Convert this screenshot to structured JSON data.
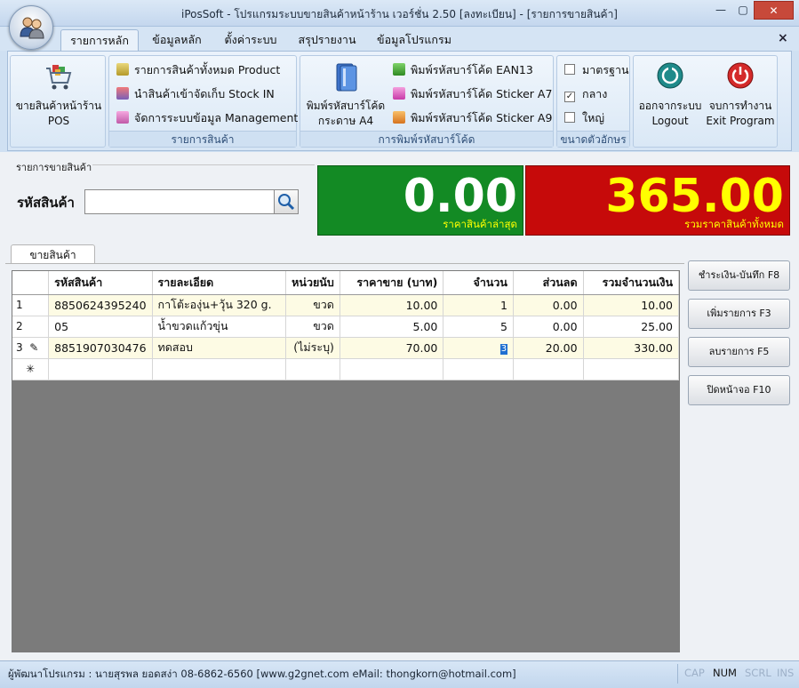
{
  "window": {
    "title": "iPosSoft - โปรแกรมระบบขายสินค้าหน้าร้าน เวอร์ชั่น 2.50 [ลงทะเบียน] - [รายการขายสินค้า]",
    "min_glyph": "—",
    "max_glyph": "▢",
    "close_glyph": "✕"
  },
  "tabs": [
    {
      "label": "รายการหลัก",
      "active": true
    },
    {
      "label": "ข้อมูลหลัก"
    },
    {
      "label": "ตั้งค่าระบบ"
    },
    {
      "label": "สรุปรายงาน"
    },
    {
      "label": "ข้อมูลโปรแกรม"
    }
  ],
  "ribbon": {
    "close_glyph": "×",
    "pos": {
      "line1": "ขายสินค้าหน้าร้าน",
      "line2": "POS"
    },
    "products_group": {
      "label": "รายการสินค้า",
      "items": [
        {
          "label": "รายการสินค้าทั้งหมด Product"
        },
        {
          "label": "นำสินค้าเข้าจัดเก็บ Stock IN"
        },
        {
          "label": "จัดการระบบข้อมูล Management"
        }
      ]
    },
    "barcode_group": {
      "label": "การพิมพ์รหัสบาร์โค้ด",
      "a4": {
        "line1": "พิมพ์รหัสบาร์โค้ด",
        "line2": "กระดาษ A4"
      },
      "items": [
        {
          "label": "พิมพ์รหัสบาร์โค้ด EAN13"
        },
        {
          "label": "พิมพ์รหัสบาร์โค้ด Sticker A7"
        },
        {
          "label": "พิมพ์รหัสบาร์โค้ด Sticker A9"
        }
      ]
    },
    "font_group": {
      "label": "ขนาดตัวอักษร",
      "options": [
        {
          "label": "มาตรฐาน",
          "checked": false
        },
        {
          "label": "กลาง",
          "checked": true
        },
        {
          "label": "ใหญ่",
          "checked": false
        }
      ]
    },
    "logout": {
      "line1": "ออกจากระบบ",
      "line2": "Logout"
    },
    "exit": {
      "line1": "จบการทำงาน",
      "line2": "Exit Program"
    }
  },
  "sale": {
    "section_label": "รายการขายสินค้า",
    "code_label": "รหัสสินค้า",
    "code_value": "",
    "last_price": {
      "value": "0.00",
      "caption": "ราคาสินค้าล่าสุด"
    },
    "total": {
      "value": "365.00",
      "caption": "รวมราคาสินค้าทั้งหมด"
    },
    "tab_label": "ขายสินค้า"
  },
  "grid": {
    "headers": [
      "รหัสสินค้า",
      "รายละเอียด",
      "หน่วยนับ",
      "ราคาขาย (บาท)",
      "จำนวน",
      "ส่วนลด",
      "รวมจำนวนเงิน"
    ],
    "rows": [
      {
        "no": "1",
        "code": "8850624395240",
        "desc": "กาโต้ะองุ่น+วุ้น 320 g.",
        "unit": "ขวด",
        "price": "10.00",
        "qty": "1",
        "disc": "0.00",
        "sum": "10.00"
      },
      {
        "no": "2",
        "code": "05",
        "desc": "น้ำขวดแก้วขุ่น",
        "unit": "ขวด",
        "price": "5.00",
        "qty": "5",
        "disc": "0.00",
        "sum": "25.00"
      },
      {
        "no": "3",
        "code": "8851907030476",
        "desc": "ทดสอบ",
        "unit": "(ไม่ระบุ)",
        "price": "70.00",
        "qty": "3",
        "disc": "20.00",
        "sum": "330.00"
      }
    ],
    "new_row_glyph": "✳",
    "edit_glyph": "✎"
  },
  "actions": [
    {
      "label": "ชำระเงิน-บันทึก F8"
    },
    {
      "label": "เพิ่มรายการ F3"
    },
    {
      "label": "ลบรายการ F5"
    },
    {
      "label": "ปิดหน้าจอ F10"
    }
  ],
  "status": {
    "developer": "ผู้พัฒนาโปรแกรม : นายสุรพล ยอดสง่า 08-6862-6560 [www.g2gnet.com  eMail: thongkorn@hotmail.com]",
    "caps": "CAP",
    "num": "NUM",
    "scrl": "SCRL",
    "ins": "INS"
  },
  "colors": {
    "last_price_bg": "#138a24",
    "total_bg": "#c60a0a",
    "total_text": "#ffff00",
    "caption_text": "#ffff00"
  }
}
